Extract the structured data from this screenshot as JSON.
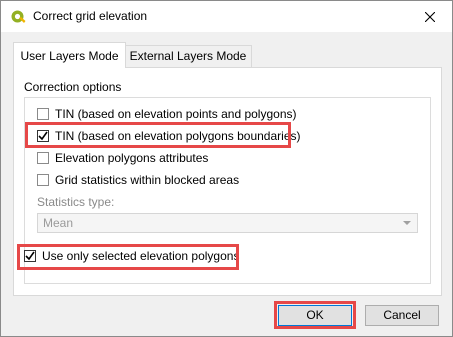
{
  "window": {
    "title": "Correct grid elevation"
  },
  "tabs": [
    {
      "label": "User Layers Mode",
      "active": true
    },
    {
      "label": "External Layers Mode",
      "active": false
    }
  ],
  "group": {
    "title": "Correction options"
  },
  "options": [
    {
      "label": "TIN (based on elevation points and polygons)",
      "checked": false
    },
    {
      "label": "TIN (based on elevation polygons boundaries)",
      "checked": true
    },
    {
      "label": "Elevation polygons attributes",
      "checked": false
    },
    {
      "label": "Grid statistics within blocked areas",
      "checked": false
    }
  ],
  "statistics": {
    "label": "Statistics type:",
    "value": "Mean"
  },
  "selected_only": {
    "label": "Use only selected elevation polygons",
    "checked": true
  },
  "buttons": {
    "ok": "OK",
    "cancel": "Cancel"
  },
  "colors": {
    "highlight": "#e64848",
    "accent": "#0078d7"
  }
}
